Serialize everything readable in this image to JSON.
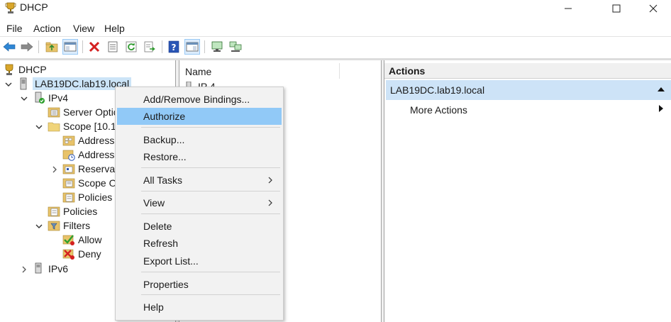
{
  "window": {
    "title": "DHCP"
  },
  "menu": [
    "File",
    "Action",
    "View",
    "Help"
  ],
  "tree": {
    "root": "DHCP",
    "server": "LAB19DC.lab19.local",
    "ipv4": "IPv4",
    "server_options": "Server Optic",
    "scope": "Scope [10.10",
    "address_pool": "Address",
    "address_leases": "Address",
    "reservations": "Reservat",
    "scope_options": "Scope O",
    "scope_policies": "Policies",
    "policies": "Policies",
    "filters": "Filters",
    "allow": "Allow",
    "deny": "Deny",
    "ipv6": "IPv6"
  },
  "list": {
    "column_name": "Name",
    "partial_row": "IP 4"
  },
  "actions": {
    "header": "Actions",
    "selected": "LAB19DC.lab19.local",
    "more": "More Actions"
  },
  "context_menu": {
    "add_remove_bindings": "Add/Remove Bindings...",
    "authorize": "Authorize",
    "backup": "Backup...",
    "restore": "Restore...",
    "all_tasks": "All Tasks",
    "view": "View",
    "delete": "Delete",
    "refresh": "Refresh",
    "export_list": "Export List...",
    "properties": "Properties",
    "help": "Help"
  },
  "colors": {
    "highlight": "#91c9f7",
    "selection": "#cde3f7",
    "accent": "#1e74c8"
  }
}
